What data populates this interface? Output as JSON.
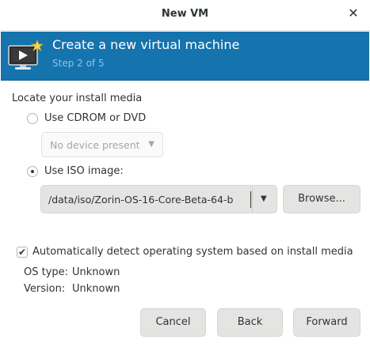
{
  "window": {
    "title": "New VM",
    "close_icon": "close-icon"
  },
  "banner": {
    "title": "Create a new virtual machine",
    "step": "Step 2 of 5",
    "background": "#1573ad",
    "icon": "vm-monitor-icon"
  },
  "install_media": {
    "heading": "Locate your install media",
    "cdrom_label": "Use CDROM or DVD",
    "cdrom_selected": false,
    "cdrom_device": "No device present",
    "iso_label": "Use ISO image:",
    "iso_selected": true,
    "iso_path": "/data/iso/Zorin-OS-16-Core-Beta-64-b",
    "browse_label": "Browse..."
  },
  "os_detect": {
    "checkbox_label": "Automatically detect operating system based on install media",
    "checked": true,
    "os_type_label": "OS type:",
    "os_type_value": "Unknown",
    "version_label": "Version:",
    "version_value": "Unknown"
  },
  "buttons": {
    "cancel": "Cancel",
    "back": "Back",
    "forward": "Forward"
  }
}
